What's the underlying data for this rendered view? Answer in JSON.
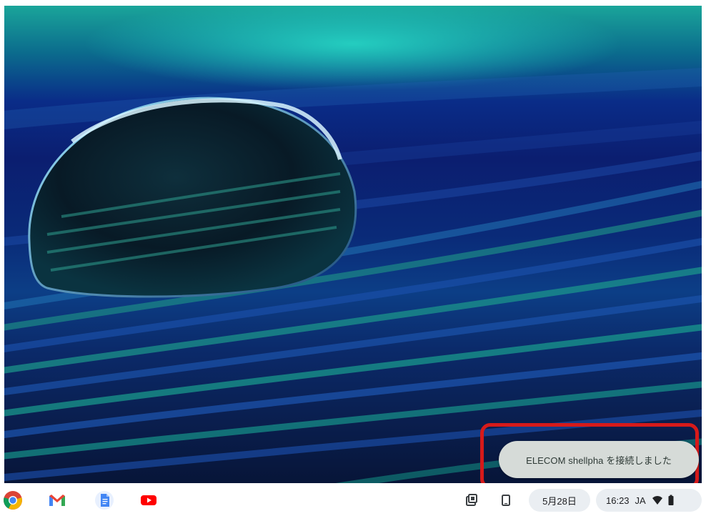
{
  "notification": {
    "message": "ELECOM shellpha を接続しました"
  },
  "shelf": {
    "apps": [
      {
        "name": "chrome-icon"
      },
      {
        "name": "gmail-icon"
      },
      {
        "name": "docs-icon"
      },
      {
        "name": "youtube-icon"
      }
    ]
  },
  "tray": {
    "date": "5月28日",
    "time": "16:23",
    "ime": "JA"
  },
  "colors": {
    "highlight": "#d61a1a",
    "toast_bg": "#d6dbd8",
    "shelf_bg": "#ffffff"
  }
}
